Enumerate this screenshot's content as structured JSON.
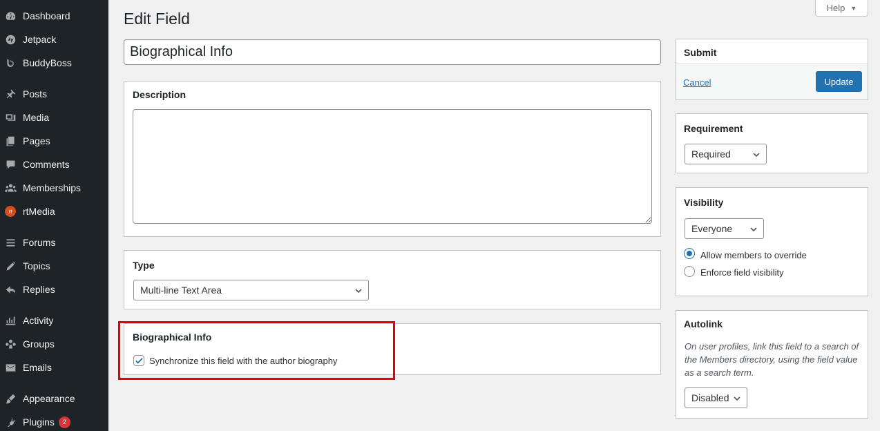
{
  "sidebar": {
    "items": [
      {
        "label": "Dashboard",
        "icon": "dashboard-icon"
      },
      {
        "label": "Jetpack",
        "icon": "jetpack-icon"
      },
      {
        "label": "BuddyBoss",
        "icon": "buddyboss-icon"
      },
      {
        "label": "Posts",
        "icon": "pin-icon"
      },
      {
        "label": "Media",
        "icon": "media-icon"
      },
      {
        "label": "Pages",
        "icon": "pages-icon"
      },
      {
        "label": "Comments",
        "icon": "comment-icon"
      },
      {
        "label": "Memberships",
        "icon": "groups-icon"
      },
      {
        "label": "rtMedia",
        "icon": "rtmedia-icon",
        "icon_text": "rt"
      },
      {
        "label": "Forums",
        "icon": "forums-icon"
      },
      {
        "label": "Topics",
        "icon": "topics-icon"
      },
      {
        "label": "Replies",
        "icon": "replies-icon"
      },
      {
        "label": "Activity",
        "icon": "activity-icon"
      },
      {
        "label": "Groups",
        "icon": "groups-icon"
      },
      {
        "label": "Emails",
        "icon": "email-icon"
      },
      {
        "label": "Appearance",
        "icon": "appearance-icon"
      },
      {
        "label": "Plugins",
        "icon": "plugins-icon",
        "badge": "2"
      }
    ]
  },
  "help": {
    "label": "Help"
  },
  "page": {
    "title": "Edit Field"
  },
  "field": {
    "name": "Biographical Info"
  },
  "description": {
    "heading": "Description",
    "value": ""
  },
  "type": {
    "heading": "Type",
    "selected": "Multi-line Text Area"
  },
  "bio": {
    "heading": "Biographical Info",
    "checkbox_label": "Synchronize this field with the author biography",
    "checked": true
  },
  "submit": {
    "heading": "Submit",
    "cancel": "Cancel",
    "update": "Update"
  },
  "requirement": {
    "heading": "Requirement",
    "selected": "Required"
  },
  "visibility": {
    "heading": "Visibility",
    "selected": "Everyone",
    "option_allow": "Allow members to override",
    "option_enforce": "Enforce field visibility"
  },
  "autolink": {
    "heading": "Autolink",
    "description": "On user profiles, link this field to a search of the Members directory, using the field value as a search term.",
    "selected": "Disabled"
  },
  "colors": {
    "accent": "#2271b1",
    "sidebar_bg": "#1d2327",
    "highlight": "#e60000",
    "badge": "#d63638"
  }
}
